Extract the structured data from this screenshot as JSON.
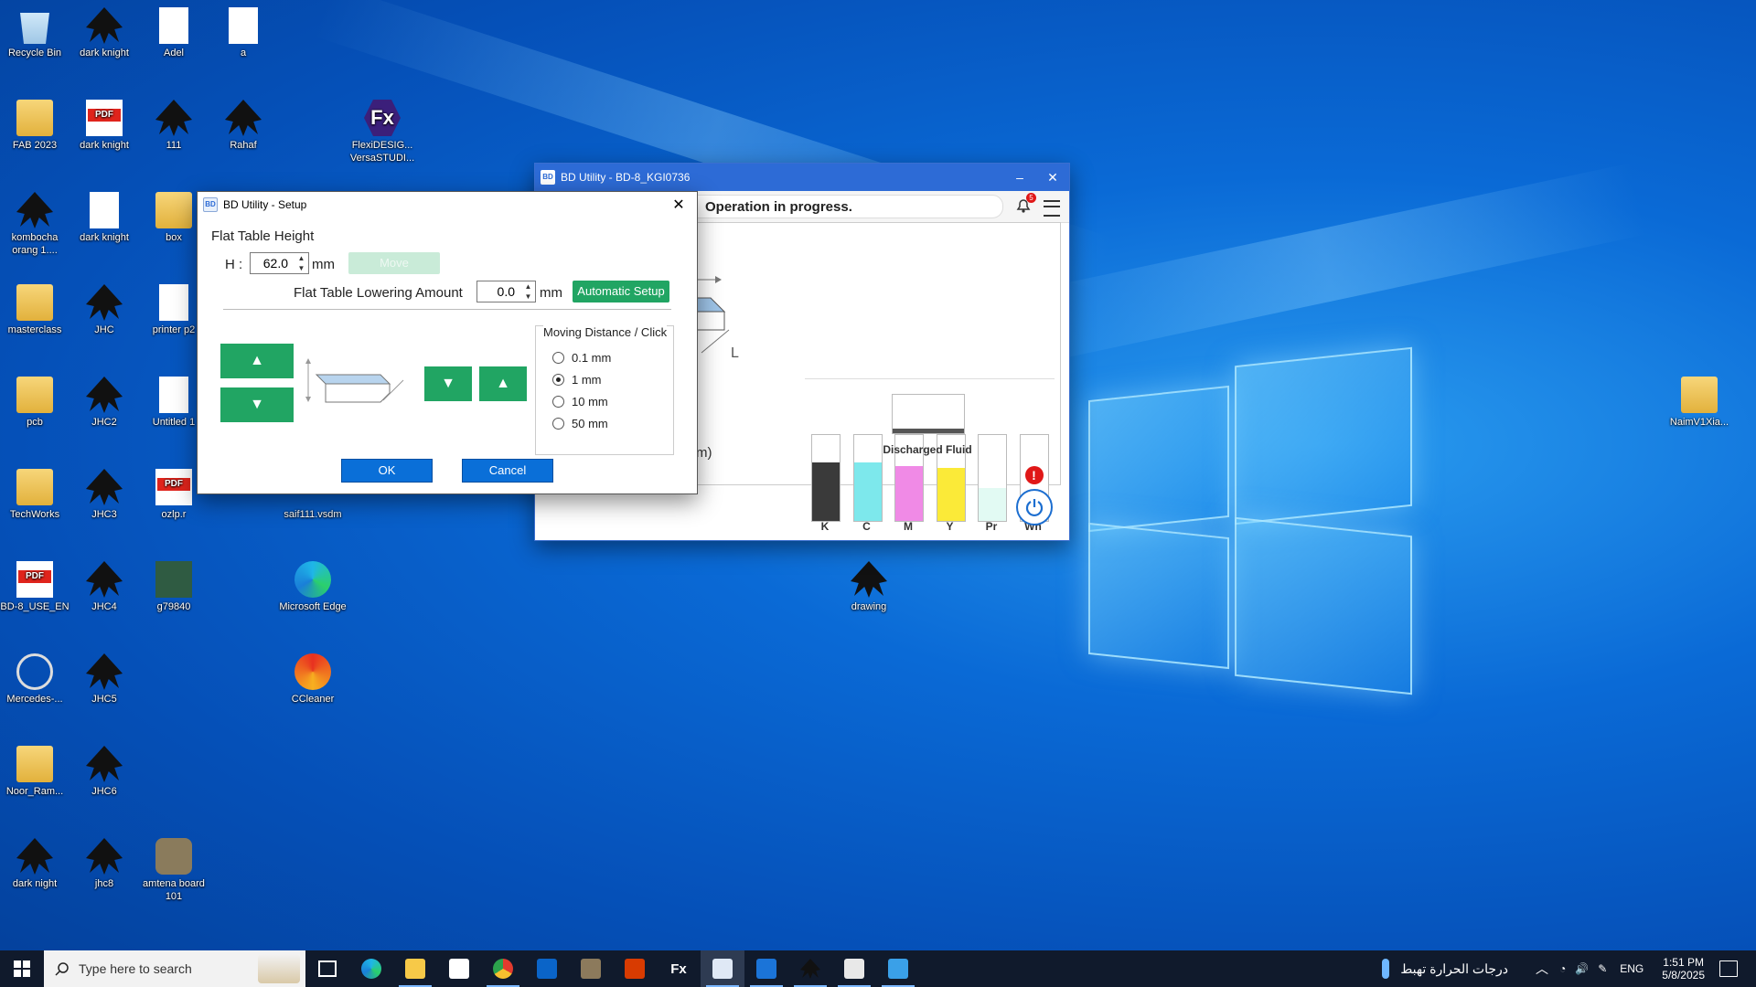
{
  "desktop": {
    "icons": [
      {
        "label": "Recycle Bin",
        "type": "bin",
        "icon": "recycle-bin-icon"
      },
      {
        "label": "dark knight",
        "type": "ink",
        "icon": "inkscape-icon"
      },
      {
        "label": "Adel",
        "type": "blank",
        "icon": "flexi-document-icon"
      },
      {
        "label": "a",
        "type": "blank",
        "icon": "blank-file-icon"
      },
      {
        "label": "FAB 2023",
        "type": "folder",
        "icon": "folder-icon"
      },
      {
        "label": "dark knight",
        "type": "pdf",
        "icon": "pdf-icon"
      },
      {
        "label": "111",
        "type": "ink",
        "icon": "inkscape-icon"
      },
      {
        "label": "Rahaf",
        "type": "ink",
        "icon": "inkscape-icon"
      },
      {
        "label": "FlexiDESIG... VersaSTUDI...",
        "type": "fx",
        "icon": "flexi-app-icon"
      },
      {
        "label": "kombocha orang 1....",
        "type": "ink",
        "icon": "inkscape-icon"
      },
      {
        "label": "dark knight",
        "type": "blank",
        "icon": "blank-file-icon"
      },
      {
        "label": "box",
        "type": "folder",
        "icon": "folder-icon"
      },
      {
        "label": "masterclass",
        "type": "folder",
        "icon": "folder-icon"
      },
      {
        "label": "JHC",
        "type": "ink",
        "icon": "inkscape-icon"
      },
      {
        "label": "printer p2",
        "type": "blank",
        "icon": "flexi-document-icon"
      },
      {
        "label": "pcb",
        "type": "folder",
        "icon": "folder-icon"
      },
      {
        "label": "JHC2",
        "type": "ink",
        "icon": "inkscape-icon"
      },
      {
        "label": "Untitled 1",
        "type": "blank",
        "icon": "blank-file-icon"
      },
      {
        "label": "TechWorks",
        "type": "folder",
        "icon": "folder-icon"
      },
      {
        "label": "JHC3",
        "type": "ink",
        "icon": "inkscape-icon"
      },
      {
        "label": "ozlp.r",
        "type": "pdf",
        "icon": "pdf-icon"
      },
      {
        "label": "saif111.vsdm",
        "type": "none",
        "icon": "file-icon"
      },
      {
        "label": "BD-8_USE_EN",
        "type": "pdf",
        "icon": "pdf-icon"
      },
      {
        "label": "JHC4",
        "type": "ink",
        "icon": "inkscape-icon"
      },
      {
        "label": "g79840",
        "type": "img",
        "icon": "image-icon"
      },
      {
        "label": "Microsoft Edge",
        "type": "edge",
        "icon": "edge-icon"
      },
      {
        "label": "drawing",
        "type": "ink",
        "icon": "inkscape-icon"
      },
      {
        "label": "Mercedes-...",
        "type": "merc",
        "icon": "mercedes-icon"
      },
      {
        "label": "JHC5",
        "type": "ink",
        "icon": "inkscape-icon"
      },
      {
        "label": "CCleaner",
        "type": "ccl",
        "icon": "ccleaner-icon"
      },
      {
        "label": "Noor_Ram...",
        "type": "folder",
        "icon": "folder-icon"
      },
      {
        "label": "JHC6",
        "type": "ink",
        "icon": "inkscape-icon"
      },
      {
        "label": "dark night",
        "type": "ink",
        "icon": "inkscape-icon"
      },
      {
        "label": "jhc8",
        "type": "ink",
        "icon": "inkscape-icon"
      },
      {
        "label": "amtena board 101",
        "type": "gimp",
        "icon": "gimp-icon"
      },
      {
        "label": "NaimV1Xia...",
        "type": "folder",
        "icon": "folder-icon"
      }
    ]
  },
  "main_window": {
    "title": "BD Utility - BD-8_KGI0736",
    "status": "Operation in progress.",
    "notification_count": "5",
    "partial_label": "m)",
    "inks": [
      {
        "name": "K",
        "level": 0.68,
        "color": "#3a3a3a"
      },
      {
        "name": "C",
        "level": 0.68,
        "color": "#7de8ec"
      },
      {
        "name": "M",
        "level": 0.64,
        "color": "#f08ae6"
      },
      {
        "name": "Y",
        "level": 0.62,
        "color": "#fbea38"
      },
      {
        "name": "Pr",
        "level": 0.38,
        "color": "#e2faf3"
      },
      {
        "name": "Wh",
        "level": 0.05,
        "color": "#f4f4f4",
        "alert": "!"
      }
    ],
    "discharged_fluid_label": "Discharged Fluid"
  },
  "setup_dialog": {
    "title": "BD Utility - Setup",
    "section_title": "Flat Table Height",
    "h_label": "H :",
    "h_value": "62.0",
    "h_unit": "mm",
    "move_button": "Move",
    "lowering_label": "Flat Table Lowering Amount",
    "lowering_value": "0.0",
    "lowering_unit": "mm",
    "auto_setup_button": "Automatic Setup",
    "moving_distance_title": "Moving Distance / Click",
    "distances": [
      {
        "label": "0.1 mm",
        "selected": false
      },
      {
        "label": "1 mm",
        "selected": true
      },
      {
        "label": "10 mm",
        "selected": false
      },
      {
        "label": "50 mm",
        "selected": false
      }
    ],
    "ok_button": "OK",
    "cancel_button": "Cancel"
  },
  "taskbar": {
    "search_placeholder": "Type here to search",
    "weather_text": "درجات الحرارة تهبط",
    "language": "ENG",
    "time": "1:51 PM",
    "date": "5/8/2025"
  }
}
